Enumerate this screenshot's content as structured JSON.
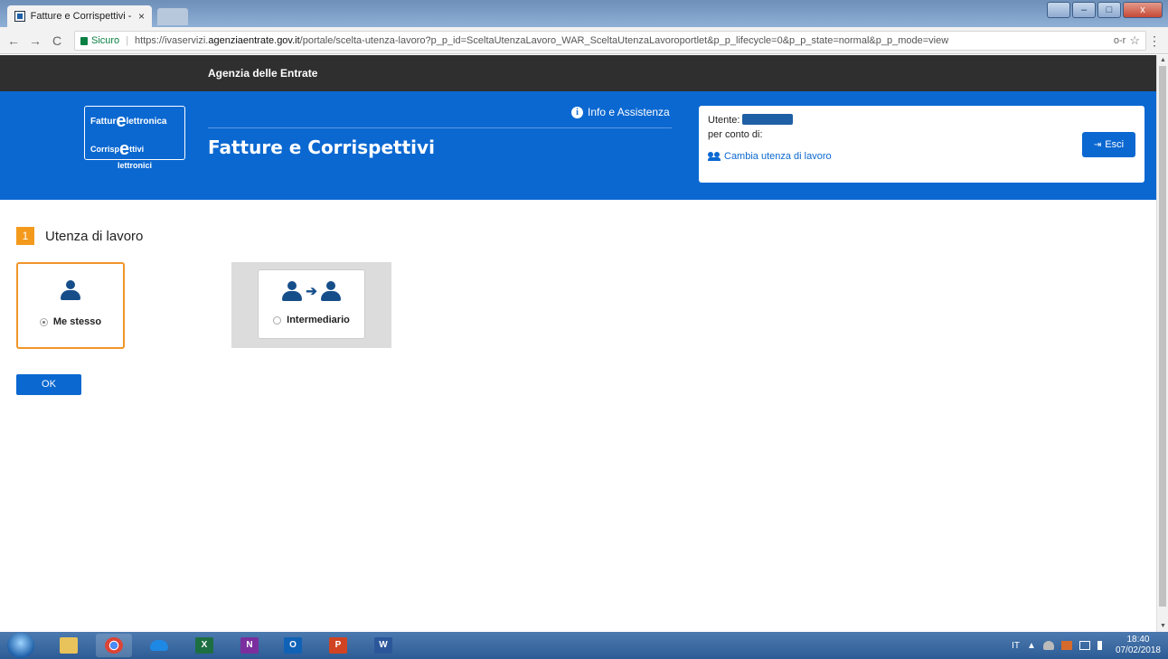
{
  "browser": {
    "tab_title": "Fatture e Corrispettivi - S",
    "tab_close": "×",
    "secure_label": "Sicuro",
    "url_prefix": "https://ivaservizi.",
    "url_domain": "agenziaentrate.gov.it",
    "url_path": "/portale/scelta-utenza-lavoro?p_p_id=SceltaUtenzaLavoro_WAR_SceltaUtenzaLavoroportlet&p_p_lifecycle=0&p_p_state=normal&p_p_mode=view",
    "back_icon": "←",
    "forward_icon": "→",
    "reload_icon": "C",
    "key_icon": "o-r",
    "star_icon": "☆",
    "menu_icon": "⋮",
    "win_min": "–",
    "win_max": "□",
    "win_close": "x"
  },
  "site": {
    "agency_name": "Agenzia delle Entrate",
    "logo_line1": "Fattur",
    "logo_line1_suffix": "lettronica",
    "logo_line2": "Corrisp",
    "logo_line2_suffix": "ttivi",
    "logo_line3": "lettronici",
    "logo_e": "e",
    "info_label": "Info e Assistenza",
    "info_icon": "i",
    "app_title": "Fatture e Corrispettivi"
  },
  "user_box": {
    "user_label": "Utente:",
    "on_behalf_label": "per conto di:",
    "change_label": "Cambia utenza di lavoro",
    "exit_label": "Esci",
    "exit_icon": "⇥"
  },
  "step": {
    "number": "1",
    "label": "Utenza di lavoro"
  },
  "choices": {
    "self_label": "Me stesso",
    "self_selected": true,
    "intermediary_label": "Intermediario",
    "intermediary_selected": false,
    "arrow": "➔"
  },
  "ok_label": "OK",
  "taskbar": {
    "excel": "X",
    "onenote": "N",
    "outlook": "O",
    "powerpoint": "P",
    "word": "W",
    "lang": "IT",
    "tray_arrow": "▲",
    "time": "18:40",
    "date": "07/02/2018"
  },
  "colors": {
    "brand_blue": "#0b68d1",
    "step_orange": "#f39a1c",
    "dark_bar": "#2f2f2f"
  }
}
